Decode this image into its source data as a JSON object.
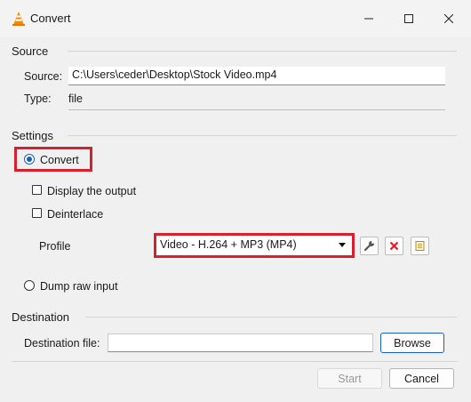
{
  "window": {
    "title": "Convert"
  },
  "source_group": {
    "label": "Source",
    "source_label": "Source:",
    "source_value": "C:\\Users\\ceder\\Desktop\\Stock Video.mp4",
    "type_label": "Type:",
    "type_value": "file"
  },
  "settings_group": {
    "label": "Settings",
    "convert_label": "Convert",
    "convert_selected": true,
    "display_output_label": "Display the output",
    "display_output_checked": false,
    "deinterlace_label": "Deinterlace",
    "deinterlace_checked": false,
    "profile_label": "Profile",
    "profile_value": "Video - H.264 + MP3 (MP4)",
    "dump_raw_label": "Dump raw input",
    "dump_raw_selected": false
  },
  "destination_group": {
    "label": "Destination",
    "dest_file_label": "Destination file:",
    "dest_file_value": "",
    "browse_label": "Browse"
  },
  "footer": {
    "start_label": "Start",
    "cancel_label": "Cancel"
  },
  "colors": {
    "highlight_box": "#d6202d",
    "accent": "#1a5fb4",
    "delete_icon": "#d6202d"
  }
}
